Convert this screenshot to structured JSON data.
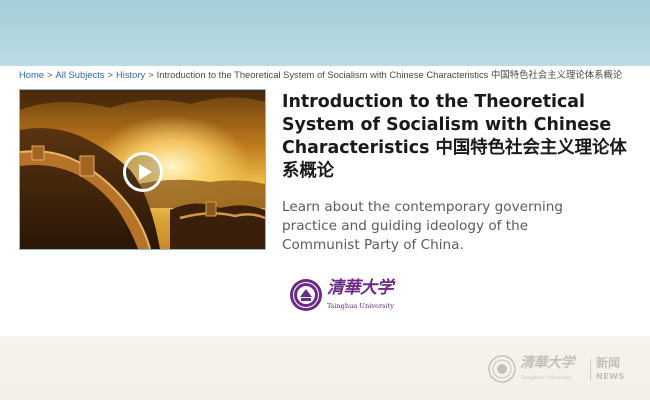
{
  "breadcrumb": {
    "items": [
      "Home",
      "All Subjects",
      "History"
    ],
    "separator": ">",
    "current": "Introduction to the Theoretical System of Socialism with Chinese Characteristics 中国特色社会主义理论体系概论"
  },
  "course": {
    "title": "Introduction to the Theoretical System of Socialism with Chinese Characteristics 中国特色社会主义理论体系概论",
    "description": "Learn about the contemporary governing practice and guiding ideology of the Communist Party of China.",
    "media_icon": "play-icon"
  },
  "partner": {
    "name_cn": "清華大学",
    "name_en": "Tsinghua University",
    "brand_color": "#6b2a84"
  },
  "watermark": {
    "name_cn": "清華大学",
    "name_en": "Tsinghua University",
    "label_cn": "新闻",
    "label_en": "NEWS"
  },
  "colors": {
    "link": "#2f6ea5",
    "top_band": "#a4cdd8",
    "title_text": "#1a1a1a",
    "description_text": "#5c5c5c"
  }
}
